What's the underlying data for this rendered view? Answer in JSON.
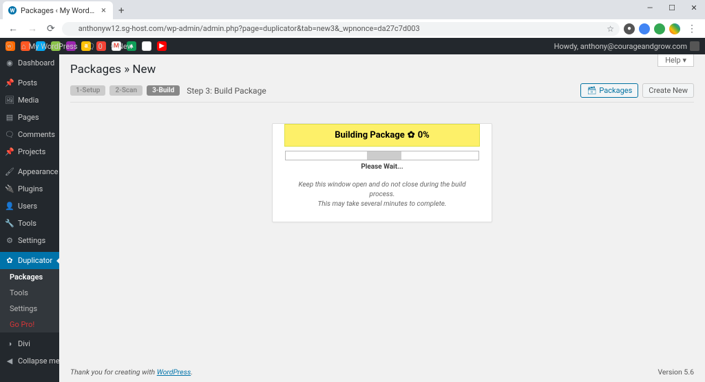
{
  "browser": {
    "tab_title": "Packages ‹ My WordPress — Wo",
    "url": "anthonyw12.sg-host.com/wp-admin/admin.php?page=duplicator&tab=new3&_wpnonce=da27c7d003"
  },
  "adminbar": {
    "site_name": "My WordPress",
    "comments_count": "0",
    "new_label": "New",
    "howdy": "Howdy, anthony@courageandgrow.com"
  },
  "menu": {
    "dashboard": "Dashboard",
    "posts": "Posts",
    "media": "Media",
    "pages": "Pages",
    "comments": "Comments",
    "projects": "Projects",
    "appearance": "Appearance",
    "plugins": "Plugins",
    "users": "Users",
    "tools": "Tools",
    "settings": "Settings",
    "duplicator": "Duplicator",
    "divi": "Divi",
    "collapse": "Collapse menu"
  },
  "submenu": {
    "packages": "Packages",
    "tools": "Tools",
    "settings": "Settings",
    "gopro": "Go Pro!"
  },
  "page": {
    "help": "Help",
    "title": "Packages » New",
    "steps": {
      "s1": "1-Setup",
      "s2": "2-Scan",
      "s3": "3-Build"
    },
    "step_desc": "Step 3: Build Package",
    "btn_packages": "Packages",
    "btn_create": "Create New"
  },
  "build": {
    "heading_prefix": "Building Package",
    "heading_pct": "0%",
    "wait": "Please Wait...",
    "note1": "Keep this window open and do not close during the build process.",
    "note2": "This may take several minutes to complete."
  },
  "footer": {
    "thanks_prefix": "Thank you for creating with ",
    "wp_link": "WordPress",
    "version": "Version 5.6"
  }
}
